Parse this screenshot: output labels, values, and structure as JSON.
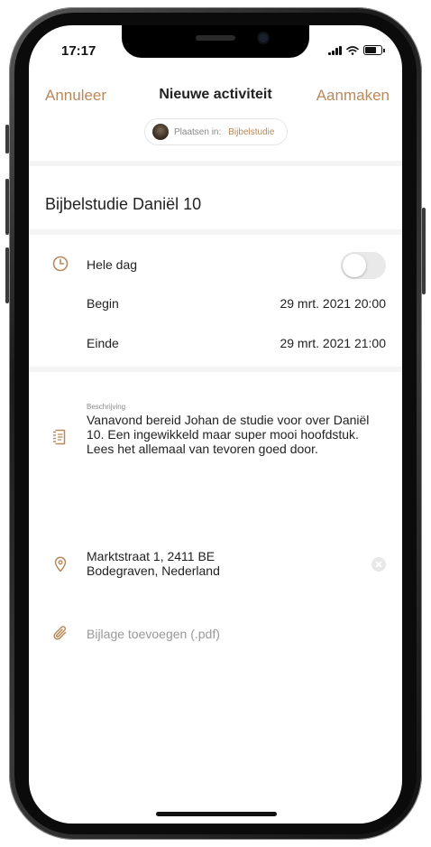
{
  "status_bar": {
    "time": "17:17",
    "icons": [
      "signal-icon",
      "wifi-icon",
      "battery-icon"
    ]
  },
  "nav": {
    "cancel_label": "Annuleer",
    "title": "Nieuwe activiteit",
    "create_label": "Aanmaken"
  },
  "post_target": {
    "prefix": "Plaatsen in:",
    "group": "Bijbelstudie"
  },
  "event": {
    "title": "Bijbelstudie Daniël 10"
  },
  "time": {
    "all_day_label": "Hele dag",
    "all_day_enabled": false,
    "begin_label": "Begin",
    "begin_value": "29 mrt. 2021 20:00",
    "end_label": "Einde",
    "end_value": "29 mrt. 2021 21:00"
  },
  "description": {
    "caption": "Beschrijving",
    "text": "Vanavond bereid Johan de studie voor over Daniël 10. Een ingewikkeld maar super mooi hoofdstuk. Lees het allemaal van tevoren goed door."
  },
  "location": {
    "line1": "Marktstraat 1, 2411 BE",
    "line2": "Bodegraven, Nederland"
  },
  "attachment": {
    "placeholder": "Bijlage toevoegen (.pdf)"
  },
  "colors": {
    "accent": "#b8895a",
    "text": "#222222",
    "muted": "#999999",
    "divider": "#f4f4f4"
  }
}
